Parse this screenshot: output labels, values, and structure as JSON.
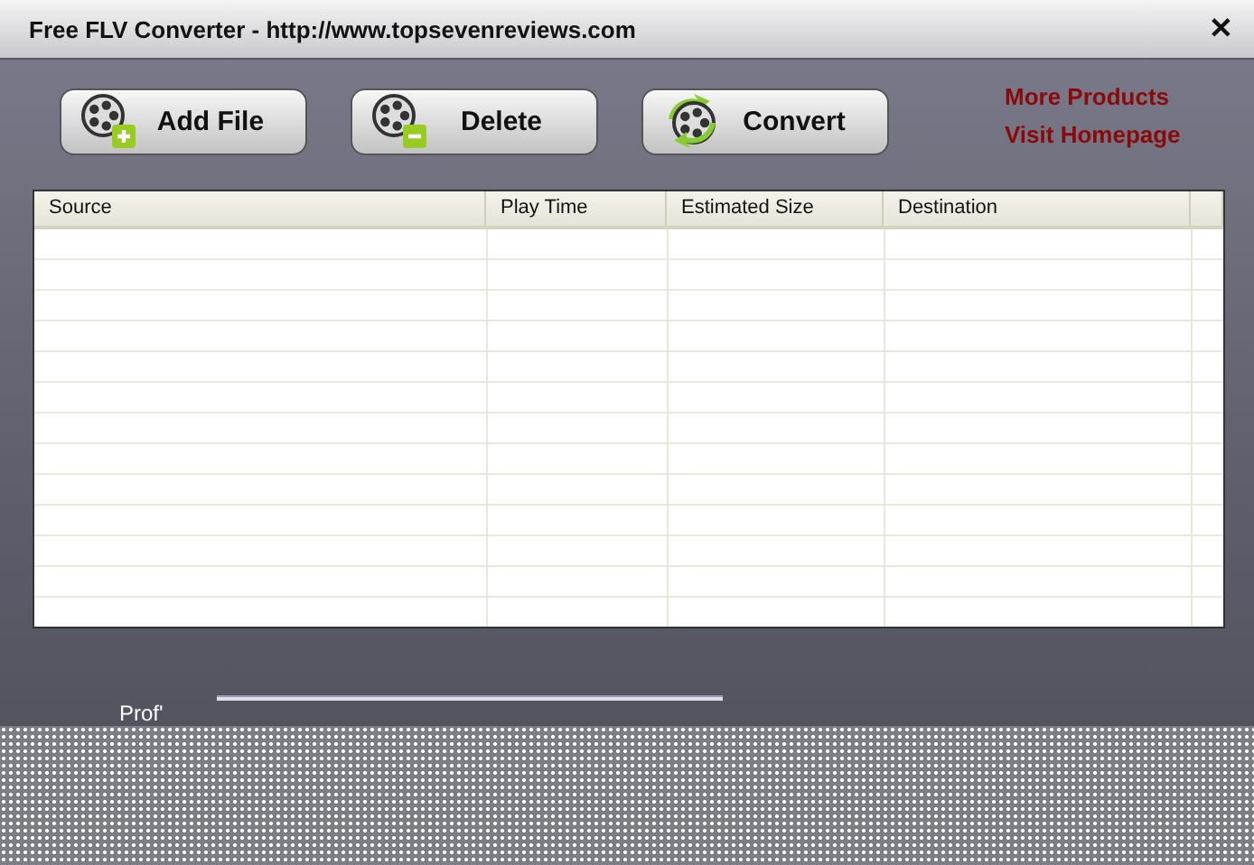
{
  "window": {
    "title": "Free FLV Converter - http://www.topsevenreviews.com",
    "close": "✕"
  },
  "toolbar": [
    {
      "kind": "add",
      "label": "Add File"
    },
    {
      "kind": "delete",
      "label": "Delete"
    },
    {
      "kind": "convert",
      "label": "Convert"
    }
  ],
  "links": [
    "More Products",
    "Visit Homepage"
  ],
  "table": {
    "columns": [
      "Source",
      "Play Time",
      "Estimated Size",
      "Destination"
    ]
  },
  "profile": {
    "label": "Prof'"
  }
}
